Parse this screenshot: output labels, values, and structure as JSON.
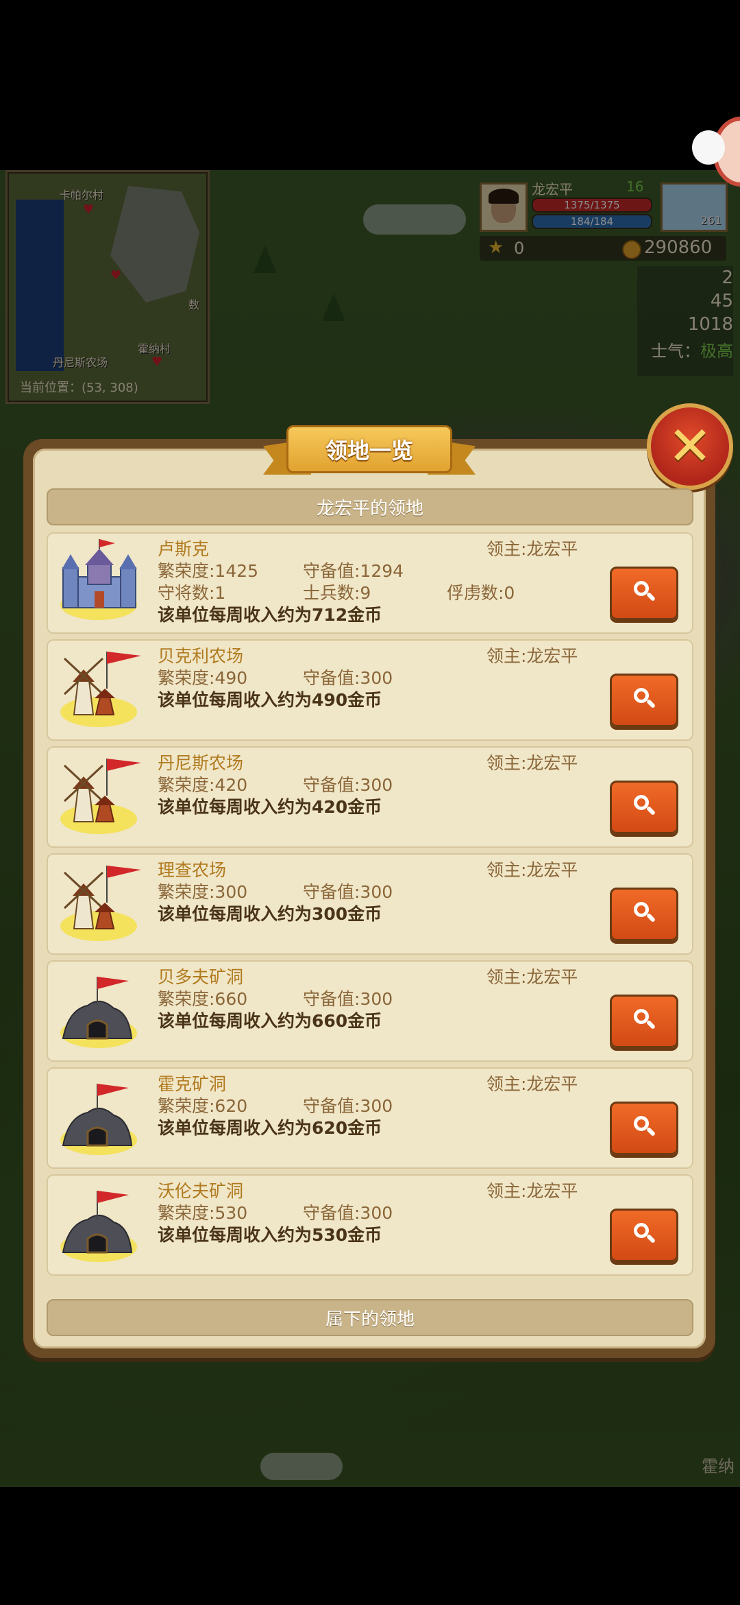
{
  "minimap": {
    "labels": [
      "卡帕尔村",
      "丹尼斯农场",
      "霍纳村",
      "数"
    ],
    "coords": "当前位置：(53, 308)"
  },
  "player": {
    "name": "龙宏平",
    "level": "16",
    "hp": "1375/1375",
    "mp": "184/184",
    "weather_value": "261",
    "gems": "0",
    "gold": "290860"
  },
  "stats": {
    "s1": "2",
    "s2": "45",
    "s3": "1018",
    "morale_label": "士气：",
    "morale_value": "极高"
  },
  "map_label_bottom": "霍纳",
  "dialog": {
    "title": "领地一览",
    "own_section": "龙宏平的领地",
    "sub_section": "属下的领地",
    "territories": [
      {
        "name": "卢斯克",
        "lord": "领主:龙宏平",
        "prosperity": "繁荣度:1425",
        "defense": "守备值:1294",
        "generals": "守将数:1",
        "soldiers": "士兵数:9",
        "prisoners": "俘虏数:0",
        "income": "该单位每周收入约为712金币",
        "icon": "castle-icon"
      },
      {
        "name": "贝克利农场",
        "lord": "领主:龙宏平",
        "prosperity": "繁荣度:490",
        "defense": "守备值:300",
        "income": "该单位每周收入约为490金币",
        "icon": "windmill-icon"
      },
      {
        "name": "丹尼斯农场",
        "lord": "领主:龙宏平",
        "prosperity": "繁荣度:420",
        "defense": "守备值:300",
        "income": "该单位每周收入约为420金币",
        "icon": "windmill-icon"
      },
      {
        "name": "理查农场",
        "lord": "领主:龙宏平",
        "prosperity": "繁荣度:300",
        "defense": "守备值:300",
        "income": "该单位每周收入约为300金币",
        "icon": "windmill-icon"
      },
      {
        "name": "贝多夫矿洞",
        "lord": "领主:龙宏平",
        "prosperity": "繁荣度:660",
        "defense": "守备值:300",
        "income": "该单位每周收入约为660金币",
        "icon": "mine-icon"
      },
      {
        "name": "霍克矿洞",
        "lord": "领主:龙宏平",
        "prosperity": "繁荣度:620",
        "defense": "守备值:300",
        "income": "该单位每周收入约为620金币",
        "icon": "mine-icon"
      },
      {
        "name": "沃伦夫矿洞",
        "lord": "领主:龙宏平",
        "prosperity": "繁荣度:530",
        "defense": "守备值:300",
        "income": "该单位每周收入约为530金币",
        "icon": "mine-icon"
      }
    ]
  }
}
